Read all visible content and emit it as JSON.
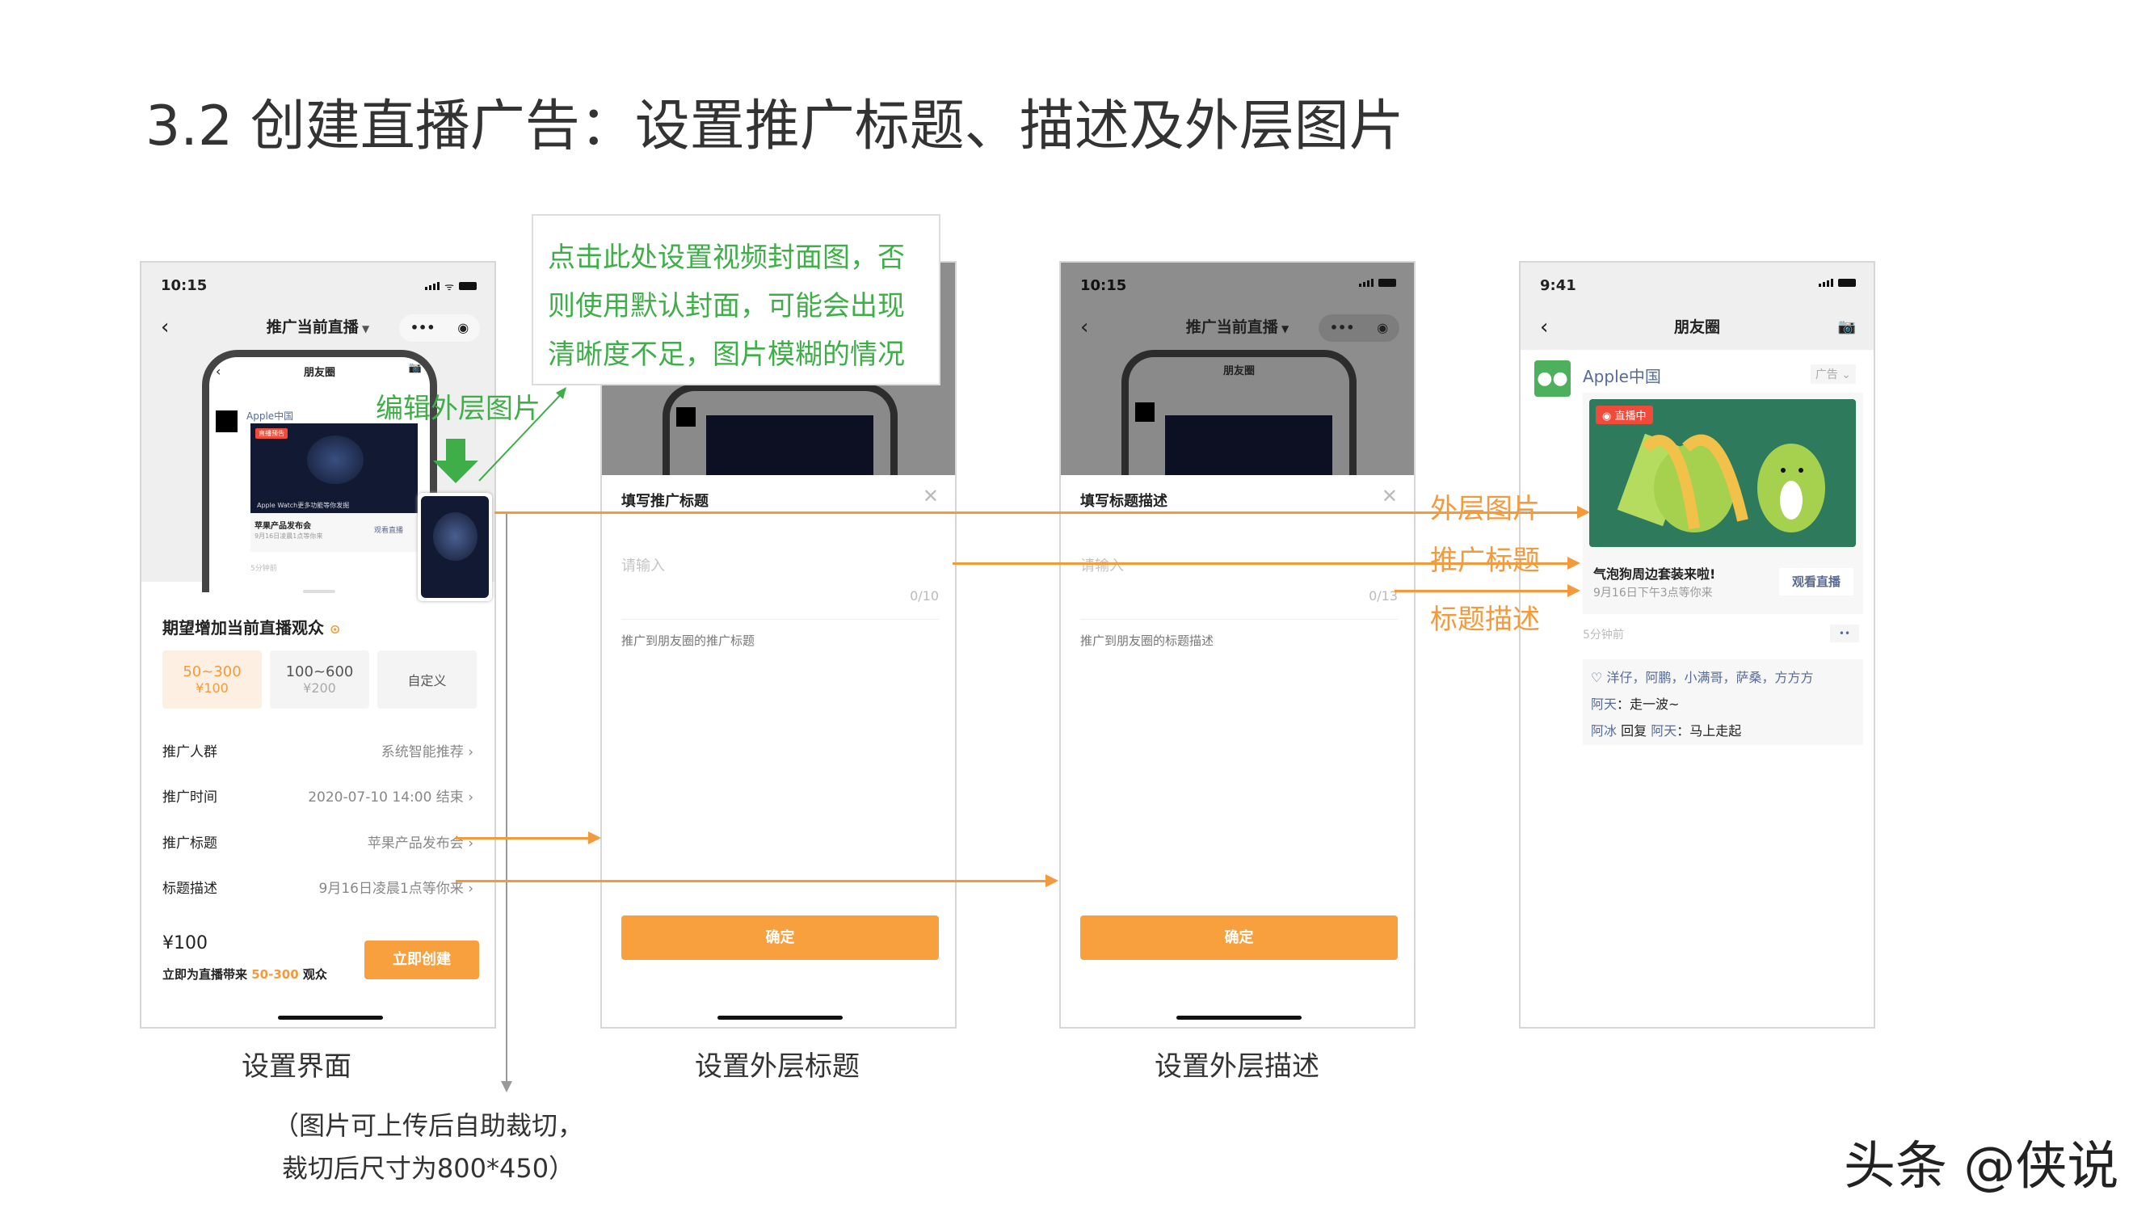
{
  "title": "3.2 创建直播广告：设置推广标题、描述及外层图片",
  "tooltip": {
    "lines": [
      "点击此处设置视频封面图，否",
      "则使用默认封面，可能会出现",
      "清晰度不足，图片模糊的情况"
    ]
  },
  "edit_label": "编辑外层图片",
  "colors": {
    "accent": "#f39a3c",
    "button": "#f7a03d",
    "annotation_green": "#3fae49",
    "link_blue": "#576b95",
    "live_red": "#f04b3a"
  },
  "phone1": {
    "time": "10:15",
    "nav_title": "推广当前直播",
    "more": "•••",
    "inner": {
      "nav": "朋友圈",
      "account": "Apple中国",
      "badge": "直播预告",
      "caption": "Apple Watch更多功能等你发掘",
      "post_title": "苹果产品发布会",
      "post_desc": "9月16日凌晨1点等你来",
      "watch": "观看直播",
      "time": "5分钟前"
    },
    "section_title": "期望增加当前直播观众",
    "options": [
      {
        "range": "50~300",
        "price": "¥100",
        "selected": true
      },
      {
        "range": "100~600",
        "price": "¥200",
        "selected": false
      },
      {
        "range": "自定义",
        "price": "",
        "selected": false
      }
    ],
    "rows": [
      {
        "label": "推广人群",
        "value": "系统智能推荐"
      },
      {
        "label": "推广时间",
        "value": "2020-07-10 14:00 结束"
      },
      {
        "label": "推广标题",
        "value": "苹果产品发布会"
      },
      {
        "label": "标题描述",
        "value": "9月16日凌晨1点等你来"
      }
    ],
    "price": "¥100",
    "summary_pre": "立即为直播带来",
    "summary_range": "50-300",
    "summary_post": "观众",
    "create_button": "立即创建"
  },
  "phone2": {
    "modal_title": "填写推广标题",
    "placeholder": "请输入",
    "count": "0/10",
    "hint": "推广到朋友圈的推广标题",
    "confirm": "确定"
  },
  "phone3": {
    "time": "10:15",
    "nav_title": "推广当前直播",
    "modal_title": "填写标题描述",
    "placeholder": "请输入",
    "count": "0/13",
    "hint": "推广到朋友圈的标题描述",
    "confirm": "确定"
  },
  "phone4": {
    "time": "9:41",
    "nav_title": "朋友圈",
    "account": "Apple中国",
    "ad_tag": "广告",
    "live_badge": "直播中",
    "post_title": "气泡狗周边套装来啦!",
    "post_desc": "9月16日下午3点等你来",
    "watch": "观看直播",
    "time_ago": "5分钟前",
    "likes": "洋仔，阿鹏，小满哥，萨桑，方方方",
    "comments": [
      {
        "name": "阿天",
        "text": "走一波~"
      },
      {
        "name": "阿冰",
        "reply_word": "回复",
        "reply_to": "阿天",
        "text": "马上走起"
      }
    ]
  },
  "annotations": [
    "外层图片",
    "推广标题",
    "标题描述"
  ],
  "captions": [
    "设置界面",
    "设置外层标题",
    "设置外层描述"
  ],
  "note": [
    "（图片可上传后自助裁切，",
    "裁切后尺寸为800*450）"
  ],
  "watermark": "头条 @侠说"
}
